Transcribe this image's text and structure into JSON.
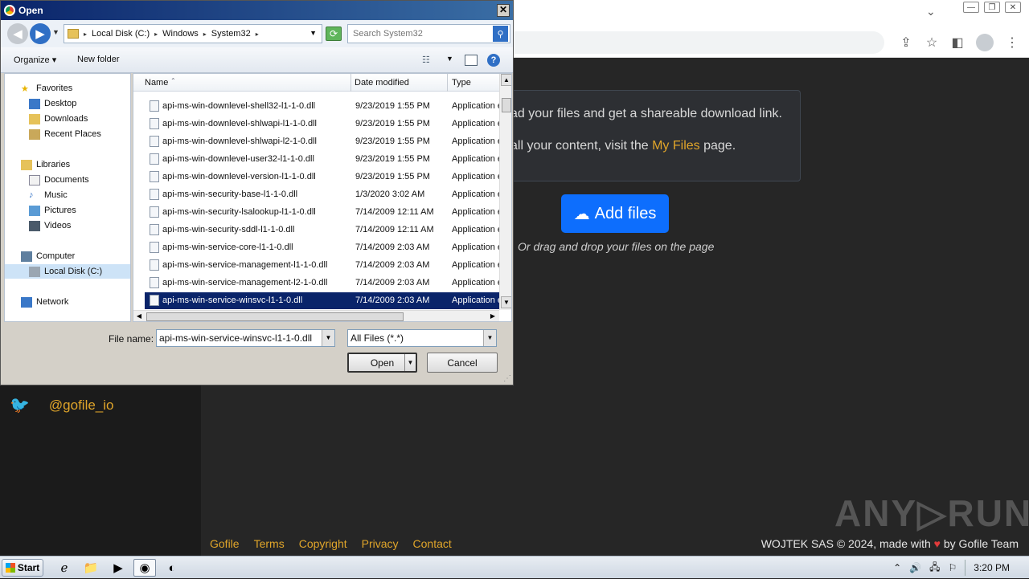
{
  "browser": {
    "window_controls": [
      "—",
      "❐",
      "✕"
    ],
    "toolbar_icons": [
      "share-icon",
      "star-icon",
      "sidebar-icon",
      "profile-icon",
      "menu-icon"
    ]
  },
  "site": {
    "info_line1": "ad your files and get a shareable download link.",
    "info_line2_prefix": "all your content, visit the",
    "info_line2_link": "My Files",
    "info_line2_suffix": "page.",
    "add_button": "Add files",
    "drag_hint": "Or drag and drop your files on the page",
    "twitter_handle": "@gofile_io",
    "footer_links": [
      "Gofile",
      "Terms",
      "Copyright",
      "Privacy",
      "Contact"
    ],
    "footer_right_prefix": "WOJTEK SAS © 2024, made with",
    "footer_right_suffix": "by Gofile Team",
    "watermark": "ANY▷RUN"
  },
  "dialog": {
    "title": "Open",
    "breadcrumb": [
      "Local Disk (C:)",
      "Windows",
      "System32"
    ],
    "search_placeholder": "Search System32",
    "organize": "Organize",
    "new_folder": "New folder",
    "nav": {
      "favorites": "Favorites",
      "desktop": "Desktop",
      "downloads": "Downloads",
      "recent": "Recent Places",
      "libraries": "Libraries",
      "documents": "Documents",
      "music": "Music",
      "pictures": "Pictures",
      "videos": "Videos",
      "computer": "Computer",
      "local_disk": "Local Disk (C:)",
      "network": "Network"
    },
    "columns": {
      "name": "Name",
      "date": "Date modified",
      "type": "Type"
    },
    "files": [
      {
        "name": "api-ms-win-downlevel-shell32-l1-1-0.dll",
        "date": "9/23/2019 1:55 PM",
        "type": "Application e"
      },
      {
        "name": "api-ms-win-downlevel-shlwapi-l1-1-0.dll",
        "date": "9/23/2019 1:55 PM",
        "type": "Application e"
      },
      {
        "name": "api-ms-win-downlevel-shlwapi-l2-1-0.dll",
        "date": "9/23/2019 1:55 PM",
        "type": "Application e"
      },
      {
        "name": "api-ms-win-downlevel-user32-l1-1-0.dll",
        "date": "9/23/2019 1:55 PM",
        "type": "Application e"
      },
      {
        "name": "api-ms-win-downlevel-version-l1-1-0.dll",
        "date": "9/23/2019 1:55 PM",
        "type": "Application e"
      },
      {
        "name": "api-ms-win-security-base-l1-1-0.dll",
        "date": "1/3/2020 3:02 AM",
        "type": "Application e"
      },
      {
        "name": "api-ms-win-security-lsalookup-l1-1-0.dll",
        "date": "7/14/2009 12:11 AM",
        "type": "Application e"
      },
      {
        "name": "api-ms-win-security-sddl-l1-1-0.dll",
        "date": "7/14/2009 12:11 AM",
        "type": "Application e"
      },
      {
        "name": "api-ms-win-service-core-l1-1-0.dll",
        "date": "7/14/2009 2:03 AM",
        "type": "Application e"
      },
      {
        "name": "api-ms-win-service-management-l1-1-0.dll",
        "date": "7/14/2009 2:03 AM",
        "type": "Application e"
      },
      {
        "name": "api-ms-win-service-management-l2-1-0.dll",
        "date": "7/14/2009 2:03 AM",
        "type": "Application e"
      },
      {
        "name": "api-ms-win-service-winsvc-l1-1-0.dll",
        "date": "7/14/2009 2:03 AM",
        "type": "Application e"
      }
    ],
    "selected_index": 11,
    "file_name_label": "File name:",
    "file_name_value": "api-ms-win-service-winsvc-l1-1-0.dll",
    "filter": "All Files (*.*)",
    "open_button": "Open",
    "cancel_button": "Cancel"
  },
  "taskbar": {
    "start": "Start",
    "clock": "3:20 PM"
  }
}
